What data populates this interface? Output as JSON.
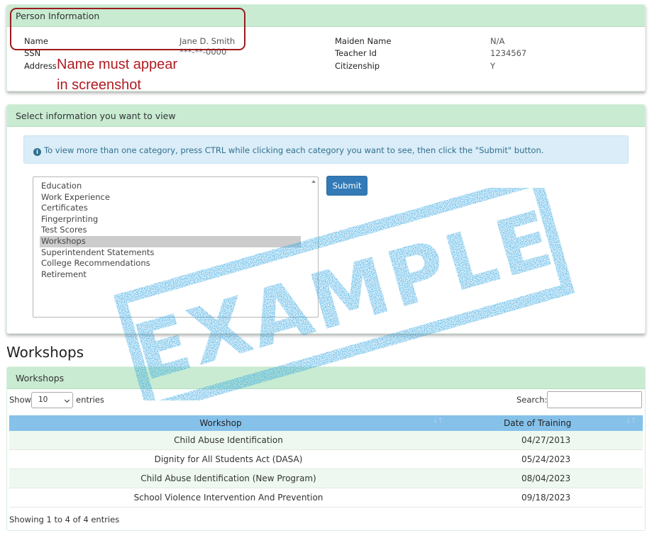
{
  "person_panel": {
    "title": "Person Information",
    "fields_left": [
      {
        "label": "Name",
        "value": "Jane D. Smith"
      },
      {
        "label": "SSN",
        "value": "***-**-0000"
      },
      {
        "label": "Address",
        "value": ""
      }
    ],
    "fields_right": [
      {
        "label": "Maiden Name",
        "value": "N/A"
      },
      {
        "label": "Teacher Id",
        "value": "1234567"
      },
      {
        "label": "Citizenship",
        "value": "Y"
      }
    ]
  },
  "annotation": {
    "line1": "Name must appear",
    "line2": "in screenshot",
    "color": "#b01b22"
  },
  "select_panel": {
    "title": "Select information you want to view",
    "info_icon": "info-circle-icon",
    "alert_text": "To view more than one category, press CTRL while clicking each category you want to see, then click the \"Submit\" button.",
    "categories": [
      "Education",
      "Work Experience",
      "Certificates",
      "Fingerprinting",
      "Test Scores",
      "Workshops",
      "Superintendent Statements",
      "College Recommendations",
      "Retirement"
    ],
    "selected": "Workshops",
    "submit_label": "Submit"
  },
  "section_title": "Workshops",
  "workshops_panel": {
    "title": "Workshops",
    "show_label": "Show",
    "entries_value": "10",
    "entries_label": "entries",
    "search_label": "Search:",
    "search_value": "",
    "columns": [
      "Workshop",
      "Date of Training"
    ],
    "rows": [
      [
        "Child Abuse Identification",
        "04/27/2013"
      ],
      [
        "Dignity for All Students Act (DASA)",
        "05/24/2023"
      ],
      [
        "Child Abuse Identification (New Program)",
        "08/04/2023"
      ],
      [
        "School Violence Intervention And Prevention",
        "09/18/2023"
      ]
    ],
    "footer": "Showing 1 to 4 of 4 entries"
  },
  "stamp": {
    "text": "EXAMPLE",
    "color": "#2ea3e0"
  },
  "colors": {
    "panel_heading": "#c8ebd2",
    "table_header": "#86c1ea",
    "submit": "#337ab7",
    "alert_bg": "#daedf8"
  }
}
